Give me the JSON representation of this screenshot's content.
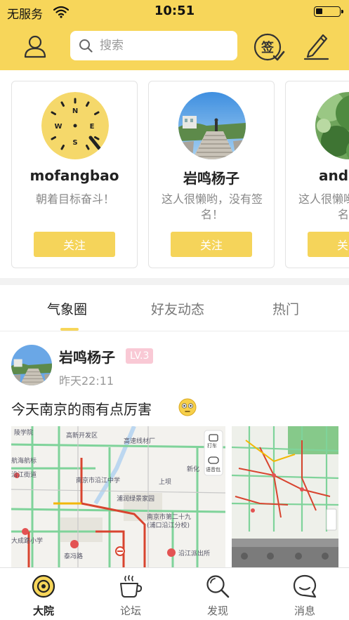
{
  "status_bar": {
    "carrier": "无服务",
    "time": "10:51",
    "battery_level": 0.3
  },
  "header": {
    "search_placeholder": "搜索",
    "icons": [
      "user-icon",
      "search-icon",
      "checkin-icon",
      "edit-icon"
    ]
  },
  "recommended_users": [
    {
      "name": "mofangbao",
      "bio": "朝着目标奋斗！",
      "follow_label": "关注",
      "avatar": "compass-clock-avatar"
    },
    {
      "name": "岩鸣杨子",
      "bio": "这人很懒哟，没有签名！",
      "follow_label": "关注",
      "avatar": "stairs-landscape-avatar"
    },
    {
      "name": "andrew",
      "bio": "这人很懒哟，没有签名！",
      "follow_label": "关注",
      "avatar": "green-trees-avatar"
    }
  ],
  "tabs": [
    {
      "label": "气象圈",
      "active": true
    },
    {
      "label": "好友动态",
      "active": false
    },
    {
      "label": "热门",
      "active": false
    }
  ],
  "post": {
    "author": "岩鸣杨子",
    "level": "LV.3",
    "time": "昨天22:11",
    "text": "今天南京的雨有点厉害",
    "emoji": "flushed-face-emoji",
    "map_labels": {
      "places": [
        "陵学院",
        "高新开发区",
        "高速线材厂",
        "航海航标",
        "南京市沿江中学",
        "沿江街道",
        "浦润绿景家园",
        "泰冯路",
        "南京市第二十九",
        "(浦口沿江分校)",
        "沿江派出所",
        "大成路小学",
        "上坝",
        "新化"
      ],
      "map_tools": [
        "打车",
        "语音包"
      ]
    }
  },
  "bottom_nav": [
    {
      "label": "大院",
      "icon": "courtyard-icon",
      "active": true
    },
    {
      "label": "论坛",
      "icon": "coffee-cup-icon",
      "active": false
    },
    {
      "label": "发现",
      "icon": "discover-search-icon",
      "active": false
    },
    {
      "label": "消息",
      "icon": "message-bubble-icon",
      "active": false
    }
  ],
  "colors": {
    "brand_yellow": "#f7d65a",
    "button_yellow": "#f5d45a",
    "level_badge": "#f9c9d5"
  }
}
